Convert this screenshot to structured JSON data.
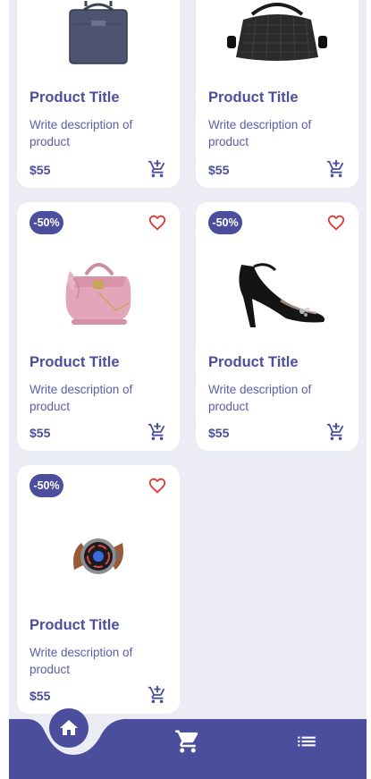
{
  "products": [
    {
      "badge": "",
      "title": "Product Title",
      "description": "Write description of product",
      "price": "$55",
      "image": "laptop-bag-icon"
    },
    {
      "badge": "",
      "title": "Product Title",
      "description": "Write description of product",
      "price": "$55",
      "image": "duffel-bag-icon"
    },
    {
      "badge": "-50%",
      "title": "Product Title",
      "description": "Write description of product",
      "price": "$55",
      "image": "pink-handbag-icon"
    },
    {
      "badge": "-50%",
      "title": "Product Title",
      "description": "Write description of product",
      "price": "$55",
      "image": "high-heel-sandal-icon"
    },
    {
      "badge": "-50%",
      "title": "Product Title",
      "description": "Write description of product",
      "price": "$55",
      "image": "smartwatch-icon"
    }
  ],
  "nav": {
    "items": [
      "home-icon",
      "cart-icon",
      "list-icon"
    ],
    "active": "home-icon"
  },
  "colors": {
    "primary": "#4b4e9c",
    "heart": "#e53935",
    "background": "#ecedf4"
  }
}
